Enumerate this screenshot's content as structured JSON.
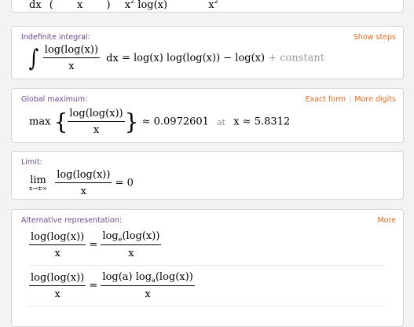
{
  "partial_pod": {
    "cut_text": "dx ( x ) x² log(x) x²"
  },
  "indefinite": {
    "title": "Indefinite integral:",
    "link": "Show steps",
    "integrand_num": "log(log(x))",
    "integrand_den": "x",
    "dx": "dx",
    "eq": "=",
    "result": "log(x) log(log(x)) − log(x)",
    "constant": "+ constant"
  },
  "maximum": {
    "title": "Global maximum:",
    "link_exact": "Exact form",
    "link_sep": "|",
    "link_digits": "More digits",
    "max_word": "max",
    "num": "log(log(x))",
    "den": "x",
    "approx_value": "≈ 0.0972601",
    "at_word": "at",
    "x_value": "x ≈ 5.8312"
  },
  "limit": {
    "title": "Limit:",
    "lim_word": "lim",
    "lim_sub": "x→±∞",
    "num": "log(log(x))",
    "den": "x",
    "result": "= 0"
  },
  "alternative": {
    "title": "Alternative representation:",
    "link": "More",
    "rows": [
      {
        "lhs_num": "log(log(x))",
        "lhs_den": "x",
        "eq": "=",
        "rhs_num": "log",
        "rhs_sub": "e",
        "rhs_num_tail": "(log(x))",
        "rhs_den": "x"
      },
      {
        "lhs_num": "log(log(x))",
        "lhs_den": "x",
        "eq": "=",
        "rhs_num": "log(a) log",
        "rhs_sub": "a",
        "rhs_num_tail": "(log(x))",
        "rhs_den": "x"
      }
    ]
  }
}
